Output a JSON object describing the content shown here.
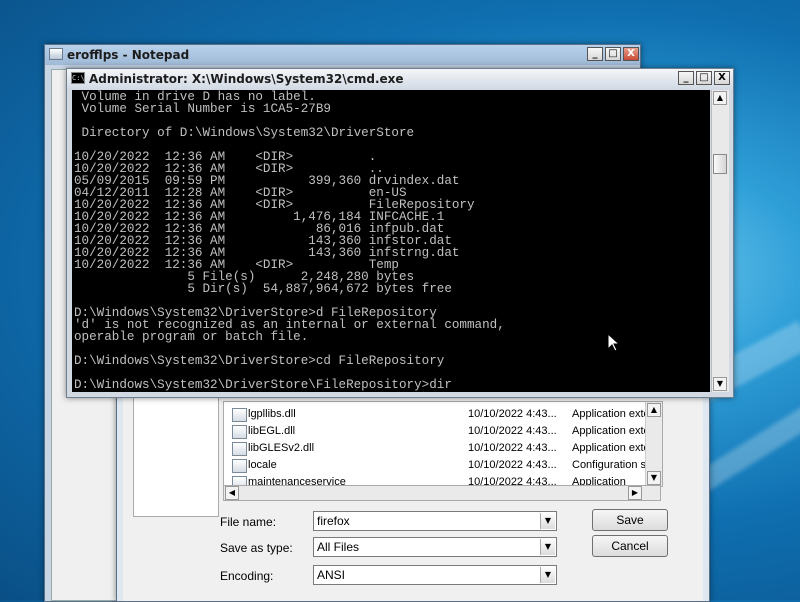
{
  "notepad": {
    "title": "erofflps - Notepad",
    "controls": {
      "minimize": "_",
      "maximize": "□",
      "close": "X"
    }
  },
  "save_dialog": {
    "files": [
      {
        "name": "lgpllibs.dll",
        "date": "10/10/2022 4:43...",
        "type": "Application exte..."
      },
      {
        "name": "libEGL.dll",
        "date": "10/10/2022 4:43...",
        "type": "Application exte..."
      },
      {
        "name": "libGLESv2.dll",
        "date": "10/10/2022 4:43...",
        "type": "Application exte..."
      },
      {
        "name": "locale",
        "date": "10/10/2022 4:43...",
        "type": "Configuration se..."
      },
      {
        "name": "maintenanceservice",
        "date": "10/10/2022 4:43...",
        "type": "Application"
      }
    ],
    "file_name_label": "File name:",
    "file_name_value": "firefox",
    "save_as_type_label": "Save as type:",
    "save_as_type_value": "All Files",
    "encoding_label": "Encoding:",
    "encoding_value": "ANSI",
    "save_label": "Save",
    "cancel_label": "Cancel"
  },
  "cmd": {
    "title": "Administrator: X:\\Windows\\System32\\cmd.exe",
    "controls": {
      "minimize": "_",
      "maximize": "□",
      "close": "X"
    },
    "console_text": " Volume in drive D has no label.\n Volume Serial Number is 1CA5-27B9\n\n Directory of D:\\Windows\\System32\\DriverStore\n\n10/20/2022  12:36 AM    <DIR>          .\n10/20/2022  12:36 AM    <DIR>          ..\n05/09/2015  09:59 PM           399,360 drvindex.dat\n04/12/2011  12:28 AM    <DIR>          en-US\n10/20/2022  12:36 AM    <DIR>          FileRepository\n10/20/2022  12:36 AM         1,476,184 INFCACHE.1\n10/20/2022  12:36 AM            86,016 infpub.dat\n10/20/2022  12:36 AM           143,360 infstor.dat\n10/20/2022  12:36 AM           143,360 infstrng.dat\n10/20/2022  12:36 AM    <DIR>          Temp\n               5 File(s)      2,248,280 bytes\n               5 Dir(s)  54,887,964,672 bytes free\n\nD:\\Windows\\System32\\DriverStore>d FileRepository\n'd' is not recognized as an internal or external command,\noperable program or batch file.\n\nD:\\Windows\\System32\\DriverStore>cd FileRepository\n\nD:\\Windows\\System32\\DriverStore\\FileRepository>dir"
  }
}
